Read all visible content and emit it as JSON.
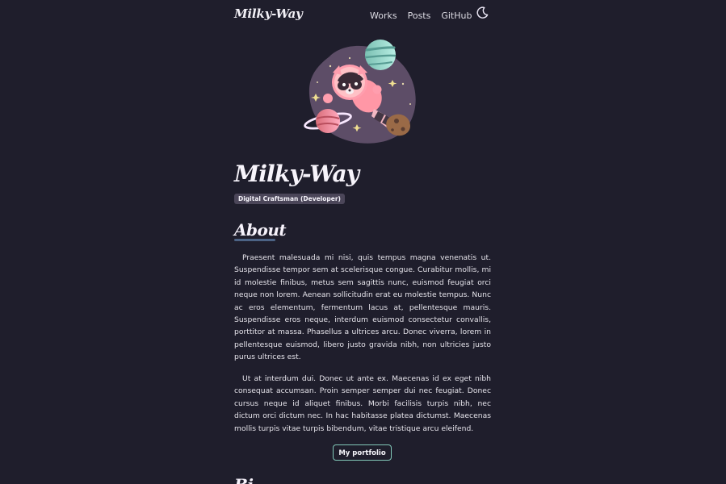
{
  "nav": {
    "logo": "Milky-Way",
    "links": [
      "Works",
      "Posts",
      "GitHub"
    ],
    "theme_icon": "moon-icon"
  },
  "hero": {
    "illustration": "raccoon-astronaut-illustration"
  },
  "profile": {
    "name": "Milky-Way",
    "role": "Digital Craftsman (Developer)"
  },
  "about": {
    "title": "About",
    "paragraphs": [
      "Praesent malesuada mi nisi, quis tempus magna venenatis ut. Suspendisse tempor sem at scelerisque congue. Curabitur mollis, mi id molestie finibus, metus sem sagittis nunc, euismod feugiat orci neque non lorem. Aenean sollicitudin erat eu molestie tempus. Nunc ac eros elementum, fermentum lacus at, pellentesque mauris. Suspendisse eros neque, interdum euismod consectetur convallis, porttitor at massa. Phasellus a ultrices arcu. Donec viverra, lorem in pellentesque euismod, libero justo gravida nibh, non ultricies justo purus ultrices est.",
      "Ut at interdum dui. Donec ut ante ex. Maecenas id ex eget nibh consequat accumsan. Proin semper semper dui nec feugiat. Donec cursus neque id aliquet finibus. Morbi facilisis turpis nibh, nec dictum orci dictum nec. In hac habitasse platea dictumst. Maecenas mollis turpis vitae turpis bibendum, vitae tristique arcu eleifend."
    ],
    "portfolio_button": "My portfolio"
  },
  "next_section": {
    "title_fragment": "Bi"
  },
  "colors": {
    "background": "#1f1e2c",
    "accent_border": "#82c9b9",
    "underline": "#4c6385",
    "badge": "#4b4659"
  }
}
